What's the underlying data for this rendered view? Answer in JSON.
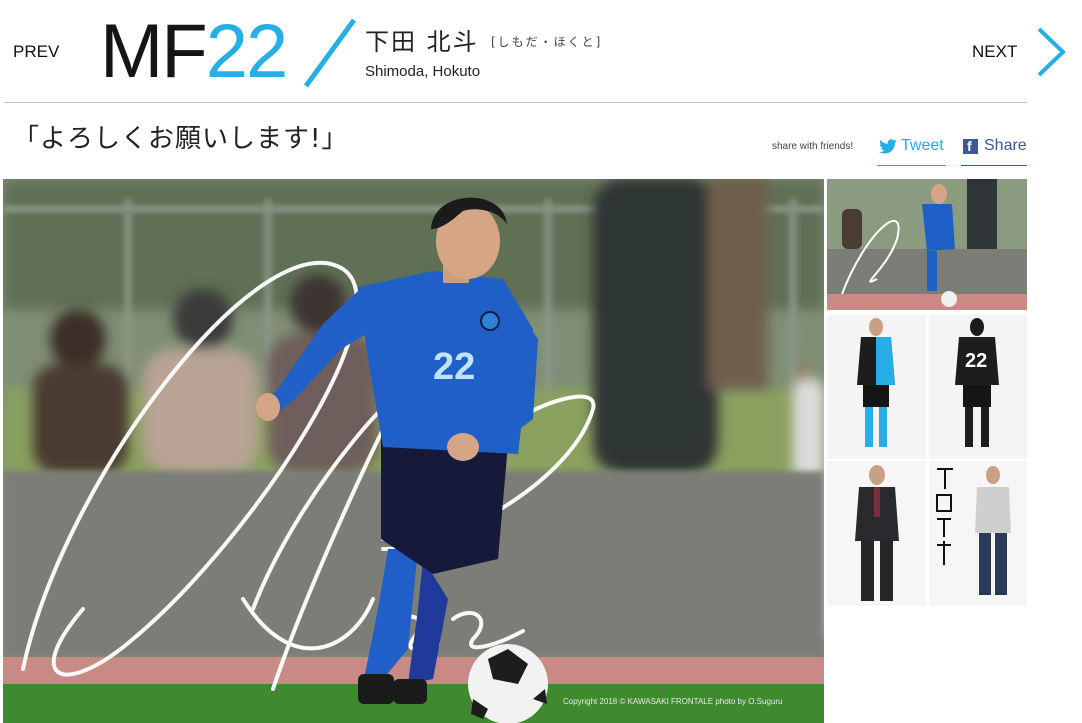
{
  "nav": {
    "prev_label": "PREV",
    "next_label": "NEXT"
  },
  "player": {
    "position": "MF",
    "number": "22",
    "name_jp": "下田 北斗",
    "name_kana": "[しもだ・ほくと]",
    "name_en": "Shimoda, Hokuto",
    "jersey_number": "22",
    "autograph_text": "22",
    "catchphrase": "「よろしくお願いします!」"
  },
  "share": {
    "label": "share with friends!",
    "tweet_label": "Tweet",
    "facebook_label": "Share"
  },
  "photo": {
    "credit": "Copyright 2018 © KAWASAKI FRONTALE photo by O.Suguru"
  },
  "thumbnails": [
    {
      "name": "action"
    },
    {
      "name": "uniform-front"
    },
    {
      "name": "uniform-back"
    },
    {
      "name": "suit"
    },
    {
      "name": "casual"
    }
  ],
  "colors": {
    "accent_blue": "#27aee6",
    "facebook_blue": "#3b5998",
    "jersey_blue": "#1f5fc7",
    "text_dark": "#151515"
  },
  "icons": {
    "next": "chevron-right-icon",
    "tweet": "twitter-bird-icon",
    "share": "facebook-icon"
  }
}
